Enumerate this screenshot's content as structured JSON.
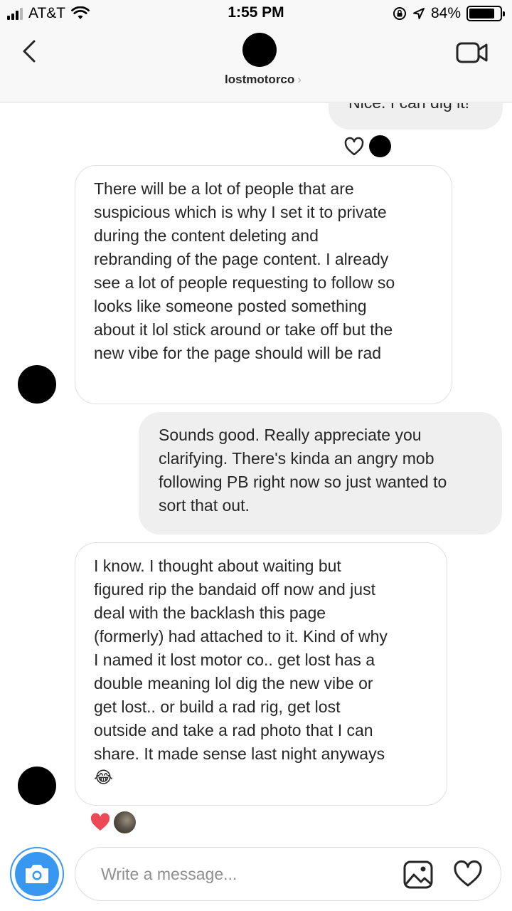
{
  "status_bar": {
    "carrier": "AT&T",
    "time": "1:55 PM",
    "battery": "84%",
    "battery_level": 0.84
  },
  "header": {
    "username": "lostmotorco",
    "chevron": "›",
    "icons": [
      "back-chevron-icon",
      "video-call-icon"
    ]
  },
  "messages": [
    {
      "sender": "me",
      "lines": [
        "Nice. I can dig it!"
      ],
      "reactions": [
        "heart-outline-icon",
        "reactor-avatar"
      ]
    },
    {
      "sender": "them",
      "lines": [
        "There will be a lot of people that are",
        "suspicious which is why I set it to private",
        "during the content deleting and",
        "rebranding of the page content. I already",
        "see a lot of people requesting to follow so",
        "looks like someone posted something",
        "about it lol stick around or take off but the",
        "new vibe for the page should will be rad"
      ]
    },
    {
      "sender": "me",
      "lines": [
        "Sounds good. Really appreciate you",
        "clarifying. There's kinda an angry mob",
        "following PB right now so just wanted to",
        "sort that out."
      ]
    },
    {
      "sender": "them",
      "lines": [
        "I know. I thought about waiting but",
        "figured rip the bandaid off now and just",
        "deal with the backlash this page",
        "(formerly) had attached to it. Kind of why",
        "I named it lost motor co.. get lost has a",
        "double meaning lol dig the new vibe or",
        "get lost.. or build a rad rig, get lost",
        "outside and take a rad photo that I can",
        "share. It made sense last night anyways",
        "😂"
      ],
      "reactions": [
        "heart-filled-icon",
        "reactor-avatar"
      ]
    }
  ],
  "composer": {
    "placeholder": "Write a message...",
    "icons": [
      "camera-icon",
      "gallery-icon",
      "heart-outline-icon"
    ]
  },
  "colors": {
    "accent": "#3897f0",
    "heart_red": "#ed4956",
    "my_bubble": "#efefef",
    "header_bg": "#f8f8f8"
  }
}
